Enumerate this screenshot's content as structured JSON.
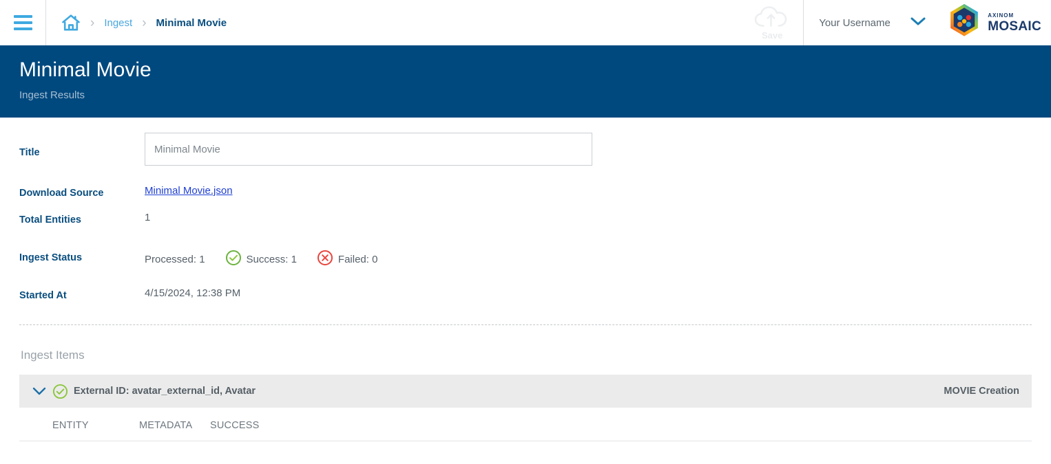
{
  "topbar": {
    "menu_icon": "hamburger-menu-icon",
    "home_icon": "home-icon",
    "breadcrumb": {
      "separator": "›",
      "items": [
        {
          "label": "Ingest",
          "current": false
        },
        {
          "label": "Minimal Movie",
          "current": true
        }
      ]
    },
    "save": {
      "label": "Save",
      "icon": "cloud-upload-icon",
      "enabled": false
    },
    "user": {
      "name": "Your Username",
      "chevron_icon": "chevron-down-icon"
    },
    "brand": {
      "sup": "AXINOM",
      "name": "MOSAIC",
      "logo_icon": "mosaic-hexagon-logo"
    }
  },
  "banner": {
    "title": "Minimal Movie",
    "subtitle": "Ingest Results",
    "background": "#00497F"
  },
  "details": {
    "title": {
      "label": "Title",
      "value": "Minimal Movie",
      "placeholder": "Minimal Movie"
    },
    "download_source": {
      "label": "Download Source",
      "link_text": "Minimal Movie.json"
    },
    "total_entities": {
      "label": "Total Entities",
      "value": "1"
    },
    "ingest_status": {
      "label": "Ingest Status",
      "processed": "Processed: 1",
      "success": "Success: 1",
      "failed": "Failed: 0",
      "success_icon": "check-circle-icon",
      "failed_icon": "x-circle-icon",
      "success_color": "#6CB33F",
      "failed_color": "#E8453C"
    },
    "started_at": {
      "label": "Started At",
      "value": "4/15/2024, 12:38 PM"
    }
  },
  "ingest_items": {
    "section_title": "Ingest Items",
    "rows": [
      {
        "chevron_icon": "chevron-down-icon",
        "status_icon": "check-circle-icon",
        "label": "External ID: avatar_external_id,  Avatar",
        "type": "MOVIE Creation"
      }
    ],
    "tabs": [
      {
        "label": "ENTITY"
      },
      {
        "label": "METADATA"
      },
      {
        "label": "SUCCESS"
      }
    ]
  }
}
